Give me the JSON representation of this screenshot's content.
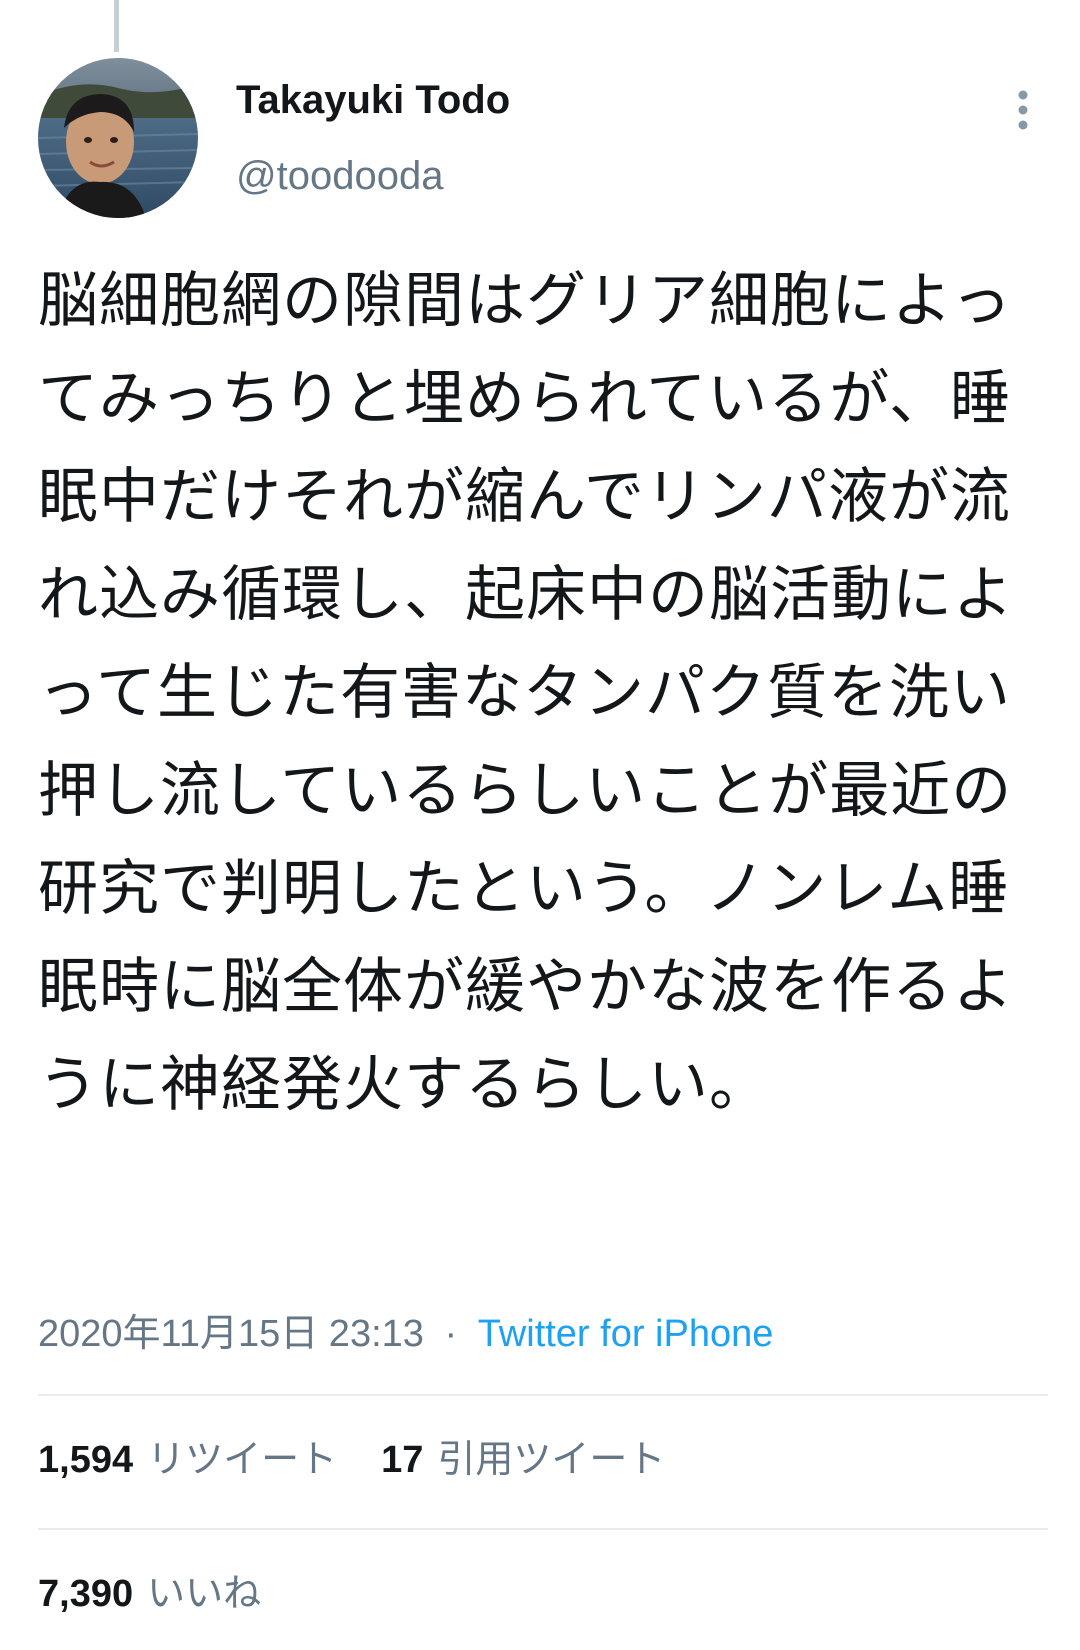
{
  "tweet": {
    "author": {
      "display_name": "Takayuki Todo",
      "handle": "@toodooda"
    },
    "text": "脳細胞網の隙間はグリア細胞によってみっちりと埋められているが、睡眠中だけそれが縮んでリンパ液が流れ込み循環し、起床中の脳活動によって生じた有害なタンパク質を洗い押し流しているらしいことが最近の研究で判明したという。ノンレム睡眠時に脳全体が緩やかな波を作るように神経発火するらしい。",
    "timestamp": "2020年11月15日 23:13",
    "separator": "·",
    "source": "Twitter for iPhone"
  },
  "stats": {
    "retweets": {
      "count": "1,594",
      "label": "リツイート"
    },
    "quote_tweets": {
      "count": "17",
      "label": "引用ツイート"
    },
    "likes": {
      "count": "7,390",
      "label": "いいね"
    }
  },
  "icons": {
    "more": "more-vertical-icon"
  },
  "colors": {
    "text": "#14171a",
    "secondary": "#657786",
    "link": "#1da1f2",
    "divider": "#e6ecf0",
    "thread_line": "#c4cfd6"
  }
}
